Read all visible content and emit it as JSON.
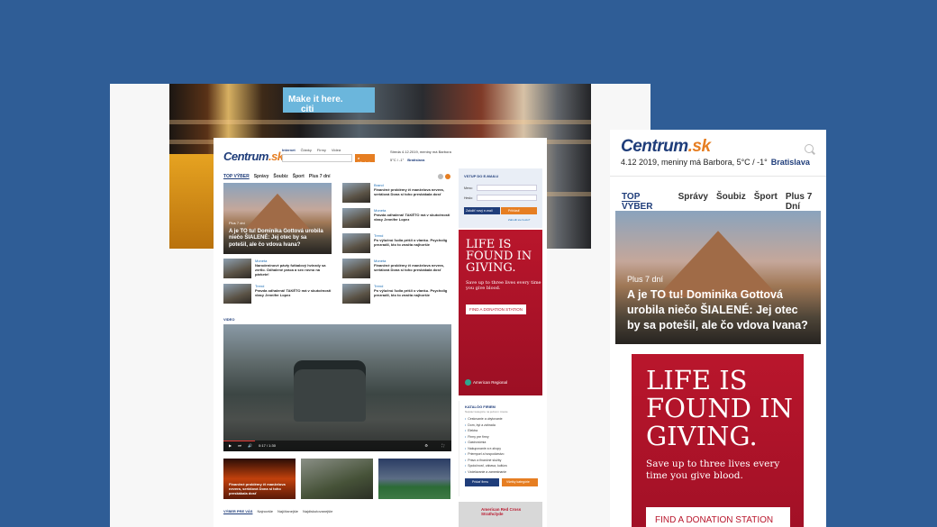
{
  "billboard": {
    "text": "Make it here.",
    "brand": "citi"
  },
  "site": {
    "logo_main": "Centrum",
    "logo_suffix": ".sk",
    "tabs": [
      "Internet",
      "Články",
      "Firmy",
      "Videá"
    ],
    "search_button": "Hľadať",
    "date_line": "Streda 4.12.2019, meniny má Barbora",
    "weather": "5°C / -1°",
    "city": "Bratislava",
    "nav": [
      "TOP VÝBER",
      "Správy",
      "Šoubiz",
      "Šport",
      "Plus 7 dní"
    ],
    "featured": {
      "category": "Plus 7 dní",
      "title": "A je TO tu! Dominika Gottová urobila niečo ŠIALENÉ: Jej otec by sa potešil, ale čo vdova Ivana?"
    },
    "news_right": [
      {
        "category": "Brand",
        "title": "Finančné problémy či manželova nevera, seriálová Dona si toho preskákala dosť"
      },
      {
        "category": "Moneta",
        "title": "Pravda odhalená! TAKÉTO má v skutočnosti vlasy Jennifer Lopez"
      },
      {
        "category": "Trend",
        "title": "Po výlučnú ľudia prišli o vlanku. Psycholig prezradil, kto to značia najhoršie"
      },
      {
        "category": "Moneta",
        "title": "Finančné problémy či manželova nevera, seriálová Dona si toho preskákala dosť"
      },
      {
        "category": "Moneta",
        "title": "Pravda odhalená! TAKÉTO má v skutočnosti vlasy Jennifer Lopez"
      },
      {
        "category": "Trend",
        "title": "Po výlučnú ľudia prišli o vlanku. Psycholig prezradil, kto to značia najhoršie"
      }
    ],
    "news_left": [
      {
        "category": "Moneta",
        "title": "Narodeninové pávty futbalový hviezdy sa zvrtlo. Odhalené práca a sex rovno na párkete!"
      },
      {
        "category": "Trend",
        "title": "Pravda odhalená! TAKÉTO má v skutočnosti vlasy Jennifer Lopez"
      }
    ],
    "login": {
      "title": "VSTUP DO E-MAILU",
      "name_label": "Meno:",
      "pass_label": "Heslo:",
      "register": "Založiť nový e-mail",
      "login": "Prihlásiť",
      "forgot": "Zabudli ste heslo?"
    },
    "video_label": "VIDEO",
    "video_time": "0:17 / 1:30",
    "video_thumb1": "Finančné problémy či manželova nevera, seriálová Dona si toho preskákala dosť",
    "catalog": {
      "title": "KATALÓG FIRIEM",
      "subtitle": "Najviac kategórie na jednom mieste",
      "items": [
        "Cestovanie a ubytovanie",
        "Dom, byt a záhrada",
        "Elektra",
        "Firmy pre firmy",
        "Gastronómia",
        "Nakupovanie a e-shopy",
        "Priemysel a hospodárstvo",
        "Právo a finančné služby",
        "Spoločnosť, zábava, kultúra",
        "Vzdelávanie a zamestnanie"
      ],
      "btn1": "Pridať firmu",
      "btn2": "Všetky kategórie"
    },
    "vybers": [
      "VÝBER PRE VÁS",
      "Najnovšie",
      "Najčítanejšie",
      "Najdiskutovanejšie"
    ],
    "bottom_ad": "American Red Cross Strathclyde"
  },
  "ad": {
    "headline": "LIFE IS FOUND IN GIVING.",
    "sub": "Save up to three lives every time you give blood.",
    "cta": "FIND A DONATION STATION",
    "footer": "American Regional"
  },
  "mobile": {
    "logo_main": "Centrum",
    "logo_suffix": ".sk",
    "date": "4.12 2019, meniny má Barbora, 5°C / -1°",
    "city": "Bratislava",
    "nav": [
      "TOP VÝBER",
      "Správy",
      "Šoubiz",
      "Šport",
      "Plus 7 Dní"
    ],
    "hero": {
      "category": "Plus 7 dní",
      "title": "A je TO tu! Dominika Gottová urobila niečo ŠIALENÉ: Jej otec by sa potešil, ale čo vdova Ivana?"
    },
    "ad": {
      "headline": "LIFE IS FOUND IN GIVING.",
      "sub": "Save up to three lives every time you give blood.",
      "cta": "FIND A DONATION STATION"
    }
  }
}
